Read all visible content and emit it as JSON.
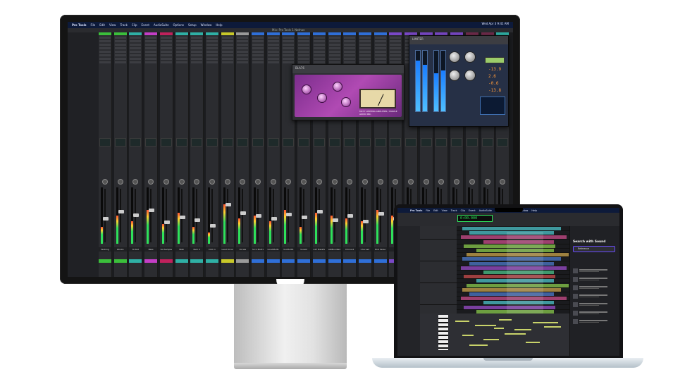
{
  "monitor": {
    "menubar": [
      "Pro Tools",
      "File",
      "Edit",
      "View",
      "Track",
      "Clip",
      "Event",
      "AudioSuite",
      "Options",
      "Setup",
      "Window",
      "Help"
    ],
    "clock": "Wed Apr 3  9:41 AM",
    "window_title": "Mix: Pro Tools 1 Nathan",
    "channel_names": [
      "Wstring",
      "Wocks",
      "M Pad",
      "Bass",
      "VocSample",
      "Stab",
      "Perk 2",
      "Click 1",
      "Lead Vocal",
      "Vocals",
      "Src1 Mult1",
      "GoodMult1",
      "VocMulti1",
      "Vocal2",
      "A17 Bassfx",
      "AIRBundled",
      "Chorus1",
      "Chorus2",
      "Dial Verse",
      "",
      "AIR Vinyl",
      "AIR Moth1",
      "AIR Moth2",
      "AIRBundled",
      "",
      "",
      ""
    ],
    "plugin_left": {
      "name": "BLA76",
      "caption": "MC77 LIMITING AMPLIFIER / PURPLE AUDIO INC."
    },
    "plugin_right": {
      "name": "LIMITER",
      "readouts": [
        "-13.9",
        "2.6",
        "-0.6",
        "-13.8"
      ]
    }
  },
  "laptop": {
    "menubar": [
      "Pro Tools",
      "File",
      "Edit",
      "View",
      "Track",
      "Clip",
      "Event",
      "AudioSuite",
      "Options",
      "Setup",
      "Window",
      "Help"
    ],
    "counter": "0:00.000",
    "side_panel": {
      "title": "Search with Sound",
      "button": "Reference"
    }
  },
  "colors": {
    "strip_caps": [
      "#3bbf3b",
      "#3bbf3b",
      "#2fb0a5",
      "#c43ec6",
      "#c0215c",
      "#2fb0a5",
      "#2fb0a5",
      "#2fb0a5",
      "#c8c829",
      "#9a9a9a",
      "#2f6fd8",
      "#2f6fd8",
      "#2f6fd8",
      "#2f6fd8",
      "#2f6fd8",
      "#2f6fd8",
      "#2f6fd8",
      "#2f6fd8",
      "#2f6fd8",
      "#7a48c8",
      "#7a48c8",
      "#7a48c8",
      "#7a48c8",
      "#7a48c8",
      "#6f2a4a",
      "#6f2a4a",
      "#2fb0a5"
    ]
  }
}
